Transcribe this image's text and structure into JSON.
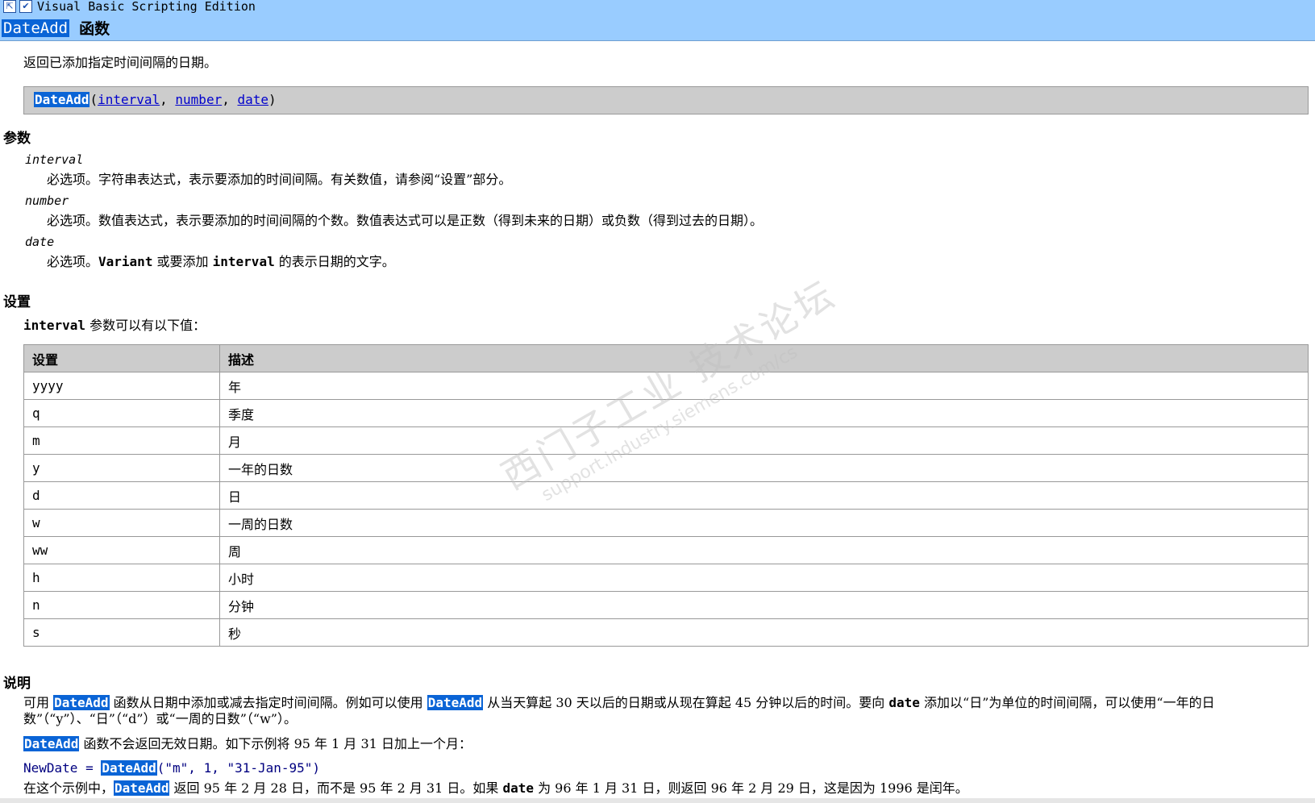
{
  "window": {
    "edition": "Visual Basic Scripting Edition",
    "func_name": "DateAdd",
    "func_word": "函数"
  },
  "intro": "返回已添加指定时间间隔的日期。",
  "syntax": {
    "func": "DateAdd",
    "open": "(",
    "arg1": "interval",
    "sep1": ", ",
    "arg2": "number",
    "sep2": ", ",
    "arg3": "date",
    "close": ")"
  },
  "params": {
    "heading": "参数",
    "items": [
      {
        "name": "interval",
        "desc": "必选项。字符串表达式，表示要添加的时间间隔。有关数值，请参阅“设置”部分。"
      },
      {
        "name": "number",
        "desc": "必选项。数值表达式，表示要添加的时间间隔的个数。数值表达式可以是正数（得到未来的日期）或负数（得到过去的日期）。"
      },
      {
        "name": "date",
        "desc_pre": "必选项。",
        "desc_kw1": "Variant",
        "desc_mid": " 或要添加 ",
        "desc_kw2": "interval",
        "desc_post": " 的表示日期的文字。"
      }
    ]
  },
  "settings": {
    "heading": "设置",
    "intro_kw": "interval",
    "intro_text": " 参数可以有以下值：",
    "headers": [
      "设置",
      "描述"
    ],
    "rows": [
      [
        "yyyy",
        "年"
      ],
      [
        "q",
        "季度"
      ],
      [
        "m",
        "月"
      ],
      [
        "y",
        "一年的日数"
      ],
      [
        "d",
        "日"
      ],
      [
        "w",
        "一周的日数"
      ],
      [
        "ww",
        "周"
      ],
      [
        "h",
        "小时"
      ],
      [
        "n",
        "分钟"
      ],
      [
        "s",
        "秒"
      ]
    ]
  },
  "watermark": {
    "line1": "西门子工业 技术论坛",
    "line2": "support.industry.siemens.com/cs"
  },
  "remarks": {
    "heading": "说明",
    "p1_a": "可用 ",
    "p1_fn": "DateAdd",
    "p1_b": " 函数从日期中添加或减去指定时间间隔。例如可以使用 ",
    "p1_fn2": "DateAdd",
    "p1_c": " 从当天算起 30 天以后的日期或从现在算起 45 分钟以后的时间。要向 ",
    "p1_kw": "date",
    "p1_d": " 添加以“日”为单位的时间间隔，可以使用“一年的日数”（“y”）、“日”（“d”）或“一周的日数”（“w”）。",
    "p2_fn": "DateAdd",
    "p2_text": " 函数不会返回无效日期。如下示例将 95 年 1 月 31 日加上一个月：",
    "code_pre": "NewDate = ",
    "code_fn": "DateAdd",
    "code_post": "(\"m\",  1,  \"31-Jan-95\")",
    "p3_a": "在这个示例中，",
    "p3_fn": "DateAdd",
    "p3_b": " 返回 95 年 2 月 28 日，而不是 95 年 2 月 31 日。如果 ",
    "p3_kw": "date",
    "p3_c": " 为 96 年 1 月 31 日，则返回 96 年 2 月 29 日，这是因为 1996 是闰年。"
  }
}
